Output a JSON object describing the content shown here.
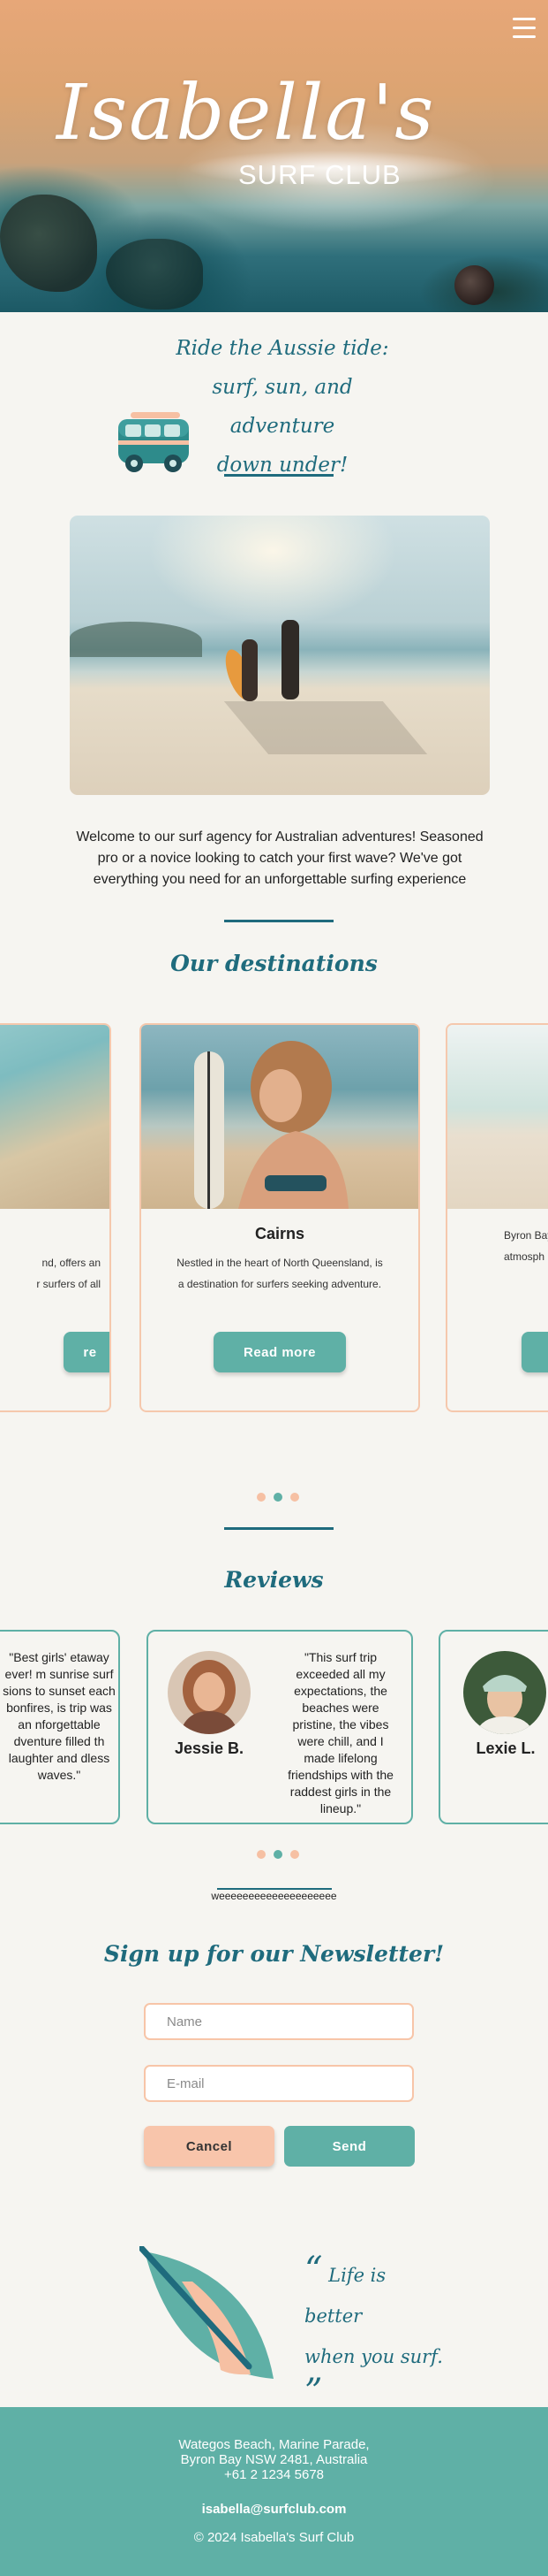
{
  "hero": {
    "title": "Isabella's",
    "subtitle": "SURF CLUB",
    "menu_icon": "hamburger-menu-icon"
  },
  "intro": {
    "tagline_lines": [
      "Ride the Aussie tide:",
      "surf, sun, and adventure",
      "down under!"
    ],
    "van_icon": "surf-van-icon",
    "welcome": "Welcome to our surf agency for Australian adventures! Seasoned pro or a novice looking to catch your first wave? We've got everything you need for an unforgettable surfing experience"
  },
  "destinations": {
    "title": "Our destinations",
    "cards": [
      {
        "name": "e",
        "desc_lines": [
          "nd, offers an",
          "r surfers of all"
        ],
        "button": "re"
      },
      {
        "name": "Cairns",
        "desc_lines": [
          "Nestled in the heart of North Queensland, is",
          "a destination for surfers seeking adventure."
        ],
        "button": "Read more"
      },
      {
        "name": "",
        "desc_lines": [
          "Byron Bay",
          "atmosph"
        ],
        "button": ""
      }
    ],
    "active_dot": 2
  },
  "reviews": {
    "title": "Reviews",
    "items": [
      {
        "name": "",
        "text": "\"Best girls' etaway ever! m sunrise surf sions to sunset each bonfires, is trip was an nforgettable dventure filled th laughter and dless waves.\""
      },
      {
        "name": "Jessie B.",
        "text": "\"This surf trip exceeded all my expectations, the beaches were pristine, the vibes were chill, and I made lifelong friendships with the raddest girls in the lineup.\""
      },
      {
        "name": "Lexie L.",
        "text": ""
      }
    ],
    "active_dot": 2,
    "footer_text": "weeeeeeeeeeeeeeeeeeee"
  },
  "newsletter": {
    "title": "Sign up for our Newsletter!",
    "name_placeholder": "Name",
    "email_placeholder": "E-mail",
    "cancel_label": "Cancel",
    "send_label": "Send"
  },
  "quote": {
    "open": "“",
    "line1": "Life is better",
    "line2": "when you surf.",
    "close": "”",
    "icon": "surfboard-icon"
  },
  "footer": {
    "address_line1": "Wategos Beach, Marine Parade,",
    "address_line2": "Byron Bay NSW 2481, Australia",
    "phone": "+61 2 1234 5678",
    "email": "isabella@surfclub.com",
    "copyright": "© 2024 Isabella's Surf Club"
  },
  "colors": {
    "teal": "#5fb0a6",
    "dark_teal": "#1f6b7d",
    "peach": "#f8c5ab",
    "background": "#f6f5f1"
  }
}
